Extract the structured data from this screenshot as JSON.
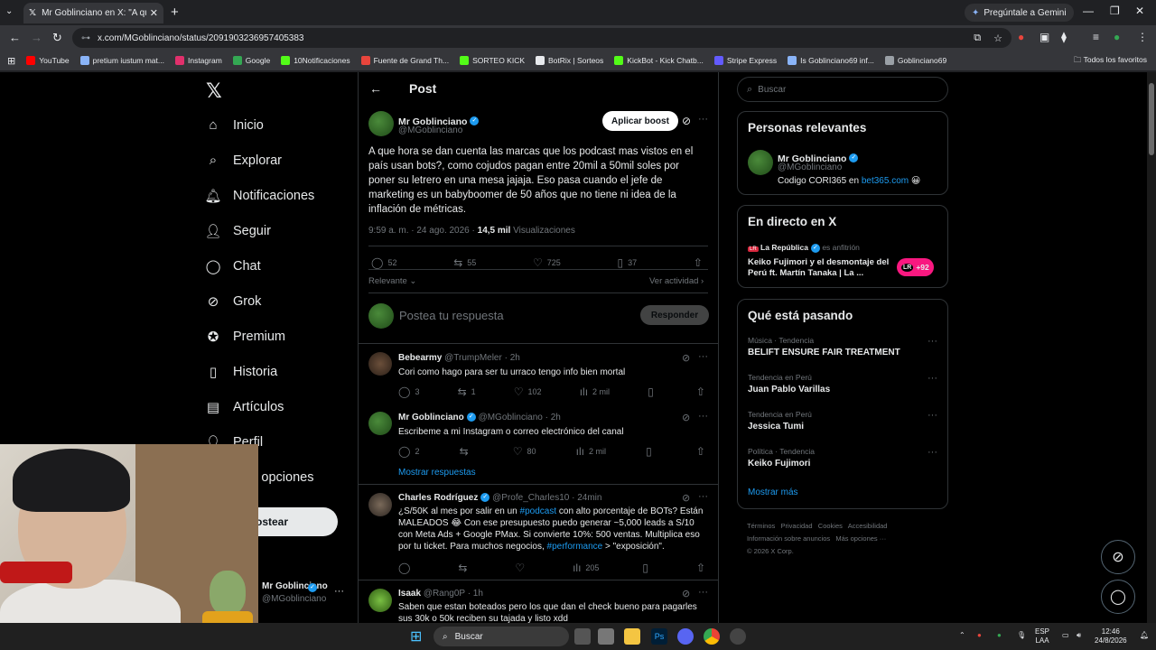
{
  "browser": {
    "tab_title": "Mr Goblinciano en X: \"A que ho",
    "url": "x.com/MGoblinciano/status/2091903236957405383",
    "gemini_label": "Pregúntale a Gemini",
    "bookmarks": [
      "YouTube",
      "pretium iustum mat...",
      "Instagram",
      "Google",
      "10Notificaciones",
      "Fuente de Grand Th...",
      "SORTEO KICK",
      "BotRix | Sorteos",
      "KickBot - Kick Chatb...",
      "Stripe Express",
      "Is Goblinciano69 inf...",
      "Goblinciano69"
    ],
    "bookmark_colors": [
      "#ff0000",
      "#8ab4f8",
      "#e1306c",
      "#34a853",
      "#53fc18",
      "#e8453c",
      "#53fc18",
      "#e8eaed",
      "#53fc18",
      "#635bff",
      "#8ab4f8",
      "#9aa0a6"
    ],
    "all_bookmarks": "Todos los favoritos"
  },
  "nav": {
    "items": [
      "Inicio",
      "Explorar",
      "Notificaciones",
      "Seguir",
      "Chat",
      "Grok",
      "Premium",
      "Historia",
      "Artículos",
      "Perfil",
      "Más opciones"
    ],
    "post_button": "Postear",
    "account_name": "Mr Goblinciano",
    "account_handle": "@MGoblinciano"
  },
  "post": {
    "header": "Post",
    "author": "Mr Goblinciano",
    "handle": "@MGoblinciano",
    "boost_button": "Aplicar boost",
    "text": "A que hora se dan cuenta las marcas que los podcast mas vistos en el país usan bots?, como cojudos pagan entre 20mil a 50mil soles por poner su letrero en una mesa jajaja. Eso pasa cuando el jefe de marketing es un babyboomer de 50 años que no tiene ni idea de la inflación de métricas.",
    "time": "9:59 a. m. · 24 ago. 2026 · ",
    "views_count": "14,5 mil",
    "views_label": "Visualizaciones",
    "replies": "52",
    "reposts": "55",
    "likes": "725",
    "bookmarks": "37",
    "sort_label": "Relevante",
    "activity_label": "Ver actividad",
    "reply_placeholder": "Postea tu respuesta",
    "reply_button": "Responder"
  },
  "replies": [
    {
      "name": "Bebearmy",
      "handle": "@TrumpMeler · 2h",
      "text": "Cori como hago para ser tu urraco tengo info bien mortal",
      "r": "3",
      "rt": "1",
      "l": "102",
      "v": "2 mil"
    },
    {
      "name": "Mr Goblinciano",
      "handle": "@MGoblinciano · 2h",
      "text": "Escribeme a mi Instagram o correo electrónico del canal",
      "r": "2",
      "rt": "",
      "l": "80",
      "v": "2 mil",
      "more": "Mostrar respuestas"
    },
    {
      "name": "Charles Rodríguez",
      "handle": "@Profe_Charles10 · 24min",
      "text_a": "¿S/50K al mes por salir en un ",
      "tag1": "#podcast",
      "text_b": " con alto porcentaje de BOTs? Están MALEADOS 😂 Con ese presupuesto puedo generar ~5,000 leads a S/10 con Meta Ads + Google PMax. Si convierte 10%: 500 ventas. Multiplica eso por tu ticket. Para muchos negocios, ",
      "tag2": "#performance",
      "text_c": " > \"exposición\".",
      "v": "205"
    },
    {
      "name": "Isaak",
      "handle": "@Rang0P · 1h",
      "text": "Saben que estan boteados pero los que dan el check bueno para pagarles sus 30k o 50k reciben su tajada y listo xdd"
    }
  ],
  "sidebar": {
    "search_placeholder": "Buscar",
    "relevant_title": "Personas relevantes",
    "relevant_name": "Mr Goblinciano",
    "relevant_handle": "@MGoblinciano",
    "relevant_bio": "Codigo CORI365 en ",
    "relevant_link": "bet365.com",
    "live_title": "En directo en X",
    "live_host": "La República",
    "live_host_suffix": " es anfitrión",
    "live_text": "Keiko Fujimori y el desmontaje del Perú ft. Martín Tanaka | La ...",
    "live_badge": "+92",
    "trending_title": "Qué está pasando",
    "trends": [
      {
        "cat": "Música · Tendencia",
        "name": "BELIFT ENSURE FAIR TREATMENT"
      },
      {
        "cat": "Tendencia en Perú",
        "name": "Juan Pablo Varillas"
      },
      {
        "cat": "Tendencia en Perú",
        "name": "Jessica Tumi"
      },
      {
        "cat": "Política · Tendencia",
        "name": "Keiko Fujimori"
      }
    ],
    "show_more": "Mostrar más",
    "footer_1": "Términos   Privacidad   Cookies   Accesibilidad",
    "footer_2": "Información sobre anuncios   Más opciones ···",
    "footer_3": "© 2026 X Corp."
  },
  "taskbar": {
    "search": "Buscar",
    "lang_1": "ESP",
    "lang_2": "LAA",
    "time": "12:46",
    "date": "24/8/2026"
  },
  "colors": {
    "accent": "#1d9bf0",
    "background": "#000000",
    "border": "#2f3336"
  }
}
